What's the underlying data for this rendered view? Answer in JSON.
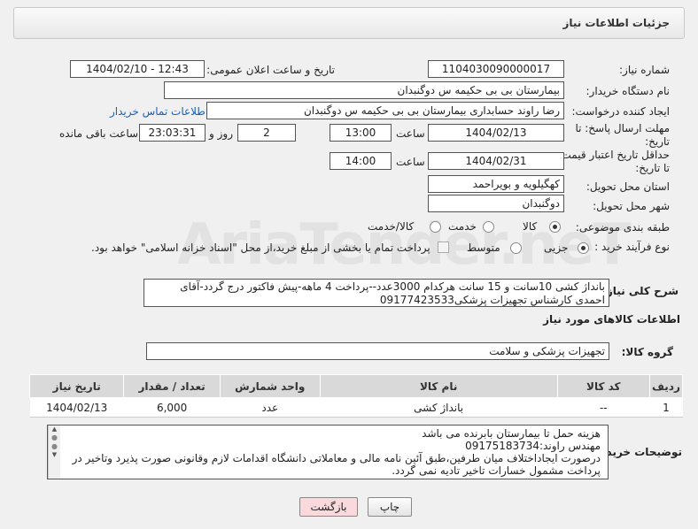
{
  "header": {
    "title": "جزئیات اطلاعات نیاز"
  },
  "fields": {
    "need_number_label": "شماره نیاز:",
    "need_number": "1104030090000017",
    "announce_label": "تاریخ و ساعت اعلان عمومی:",
    "announce_value": "1404/02/10 - 12:43",
    "buyer_org_label": "نام دستگاه خریدار:",
    "buyer_org": "بیمارستان بی بی حکیمه س  دوگنبدان",
    "requester_label": "ایجاد کننده درخواست:",
    "requester": "رضا راوند حسابداری بیمارستان بی بی حکیمه س  دوگنبدان",
    "contact_link": "اطلاعات تماس خریدار",
    "deadline_label": "مهلت ارسال پاسخ: تا تاریخ:",
    "deadline_date": "1404/02/13",
    "time_label": "ساعت",
    "deadline_time": "13:00",
    "days_value": "2",
    "days_label": "روز و",
    "remaining_time": "23:03:31",
    "remaining_label": "ساعت باقی مانده",
    "validity_label": "حداقل تاریخ اعتبار قیمت: تا تاریخ:",
    "validity_date": "1404/02/31",
    "validity_time": "14:00",
    "province_label": "استان محل تحویل:",
    "province": "کهگیلویه و بویراحمد",
    "city_label": "شهر محل تحویل:",
    "city": "دوگنبدان",
    "category_label": "طبقه بندی موضوعی:",
    "category_options": [
      "کالا",
      "خدمت",
      "کالا/خدمت"
    ],
    "process_label": "نوع فرآیند خرید :",
    "process_options": [
      "جزیی",
      "متوسط"
    ],
    "payment_note": "پرداخت تمام یا بخشی از مبلغ خرید،از محل \"اسناد خزانه اسلامی\" خواهد بود."
  },
  "description": {
    "label": "شرح کلی نیاز:",
    "text": "بانداژ کشی 10سانت و 15 سانت هرکدام 3000عدد--پرداخت 4 ماهه-پیش فاکتور درج گردد-آقای احمدی کارشناس تجهیزات پزشکی09177423533"
  },
  "goods": {
    "section_title": "اطلاعات کالاهای مورد نیاز",
    "group_label": "گروه کالا:",
    "group_value": "تجهیزات پزشکی و سلامت",
    "columns": [
      "ردیف",
      "کد کالا",
      "نام کالا",
      "واحد شمارش",
      "تعداد / مقدار",
      "تاریخ نیاز"
    ],
    "rows": [
      [
        "1",
        "--",
        "بانداژ کشی",
        "عدد",
        "6,000",
        "1404/02/13"
      ]
    ]
  },
  "buyer_notes": {
    "label": "توضیحات خریدار:",
    "lines": [
      "هزینه حمل تا بیمارستان بابرنده می باشد",
      "مهندس راوند:09175183734",
      "درصورت ایجاداختلاف میان طرفین،طبق آئین نامه مالی و معاملاتی دانشگاه اقدامات لازم وقانونی صورت پذیرد وتاخیر در",
      "پرداخت مشمول خسارات تاخیر تادیه نمی گردد."
    ]
  },
  "buttons": {
    "print": "چاپ",
    "back": "بازگشت"
  },
  "colors": {
    "back_button_bg": "#f9d9dc",
    "link": "#1a5fb4"
  }
}
